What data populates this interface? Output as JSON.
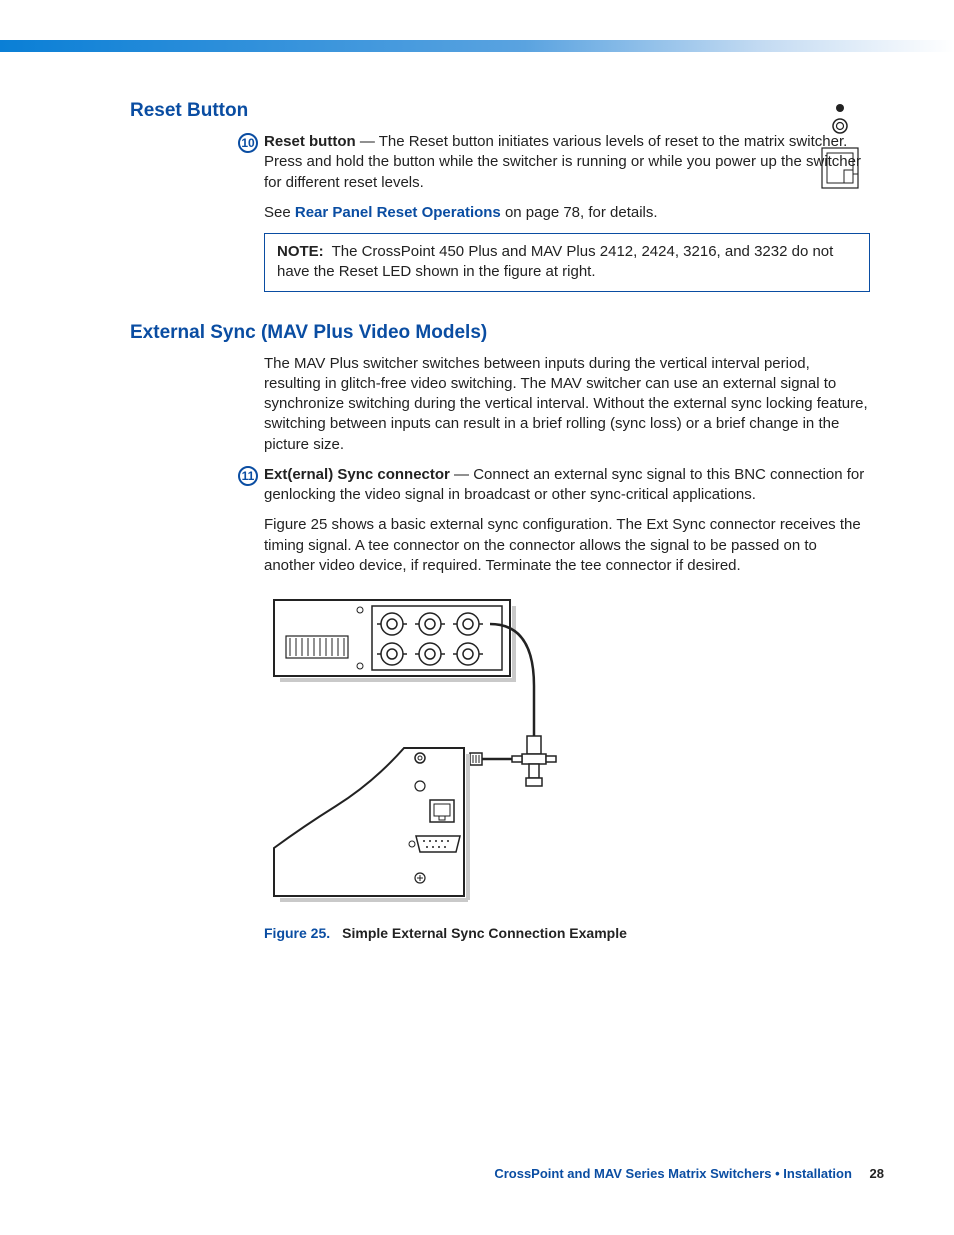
{
  "sections": {
    "reset": {
      "heading": "Reset Button",
      "callout_num": "10",
      "callout_label": "Reset button",
      "callout_text": " — The Reset button initiates various levels of reset to the matrix switcher. Press and hold the button while the switcher is running or while you power up the switcher for different reset levels.",
      "see_prefix": "See ",
      "see_link": "Rear Panel Reset Operations",
      "see_suffix": " on page 78, for details.",
      "note_label": "NOTE:",
      "note_text": "The CrossPoint 450 Plus and MAV Plus 2412, 2424, 3216, and 3232 do not have the Reset LED shown in the figure at right."
    },
    "extsync": {
      "heading": "External Sync (MAV Plus Video Models)",
      "intro": "The MAV Plus switcher switches between inputs during the vertical interval period, resulting in glitch-free video switching. The MAV switcher can use an external signal to synchronize switching during the vertical interval. Without the external sync locking feature, switching between inputs can result in a brief rolling (sync loss) or a brief change in the picture size.",
      "callout_num": "11",
      "callout_label": "Ext(ernal) Sync connector",
      "callout_text": " — Connect an external sync signal to this BNC connection for genlocking the video signal in broadcast or other sync-critical applications.",
      "para2": "Figure 25 shows a basic external sync configuration. The Ext Sync connector receives the timing signal. A tee connector on the connector allows the signal to be passed on to another video device, if required. Terminate the tee connector if desired."
    }
  },
  "figure": {
    "label": "Figure 25.",
    "title": "Simple External Sync Connection Example"
  },
  "footer": {
    "text": "CrossPoint and MAV Series Matrix Switchers • Installation",
    "page": "28"
  }
}
